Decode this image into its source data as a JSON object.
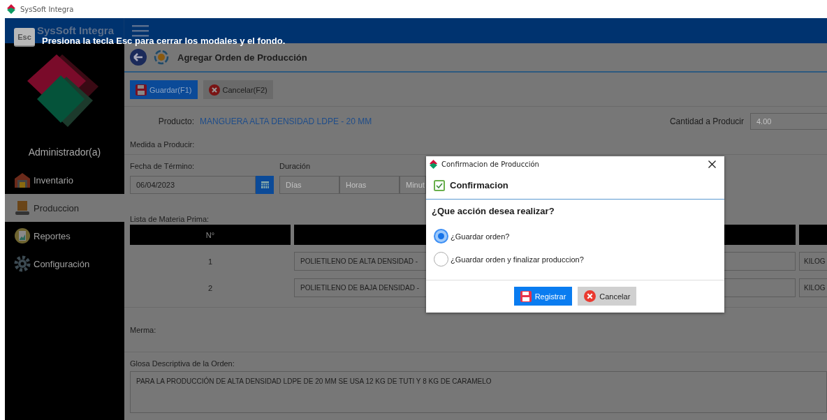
{
  "window": {
    "title": "SysSoft Integra"
  },
  "header": {
    "title": "SysSoft Integra"
  },
  "esc_hint": {
    "key": "Esc",
    "message": "Presiona la tecla Esc para cerrar los modales y el fondo."
  },
  "sidebar": {
    "user": "Administrador(a)",
    "items": [
      {
        "label": "Inventario",
        "kind": "warehouse",
        "selected": false
      },
      {
        "label": "Produccion",
        "kind": "conveyor",
        "selected": true
      },
      {
        "label": "Reportes",
        "kind": "report",
        "selected": false
      },
      {
        "label": "Configuración",
        "kind": "gear",
        "selected": false
      }
    ]
  },
  "page": {
    "title": "Agregar Orden de Producción"
  },
  "toolbar": [
    {
      "label": "Guardar(F1)",
      "kind": "save"
    },
    {
      "label": "Cancelar(F2)",
      "kind": "cancel"
    }
  ],
  "form": {
    "product_label": "Producto:",
    "product_value": "MANGUERA ALTA DENSIDAD LDPE - 20 MM",
    "quantity_label": "Cantidad a Producir",
    "quantity_value": "4.00",
    "measure_label": "Medida a Producir:",
    "end_date_label": "Fecha de Término:",
    "end_date_value": "06/04/2023",
    "duration_label": "Duración",
    "duration_placeholders": [
      "Días",
      "Horas",
      "Minut"
    ]
  },
  "materials": {
    "label": "Lista de Materia Prima:",
    "columns": [
      "N°"
    ],
    "rows": [
      {
        "number": "1",
        "name": "POLIETILENO DE ALTA DENSIDAD -",
        "unit": "KILOG"
      },
      {
        "number": "2",
        "name": "POLIETILENO DE BAJA DENSIDAD -",
        "unit": "KILOG"
      }
    ]
  },
  "waste": {
    "label": "Merma:"
  },
  "description": {
    "label": "Glosa Descriptiva de la Orden:",
    "value": "PARA LA PRODUCCIÓN DE ALTA DENSIDAD LDPE DE 20 MM SE USA 12 KG DE TUTI Y 8 KG DE CARAMELO"
  },
  "dialog": {
    "title": "Confirmacion de Producción",
    "heading": "Confirmacion",
    "question": "¿Que acción desea realizar?",
    "options": [
      {
        "label": "¿Guardar orden?",
        "selected": true
      },
      {
        "label": "¿Guardar orden y finalizar produccion?",
        "selected": false
      }
    ],
    "buttons": [
      {
        "label": "Registrar",
        "kind": "save"
      },
      {
        "label": "Cancelar",
        "kind": "cancel"
      }
    ]
  }
}
